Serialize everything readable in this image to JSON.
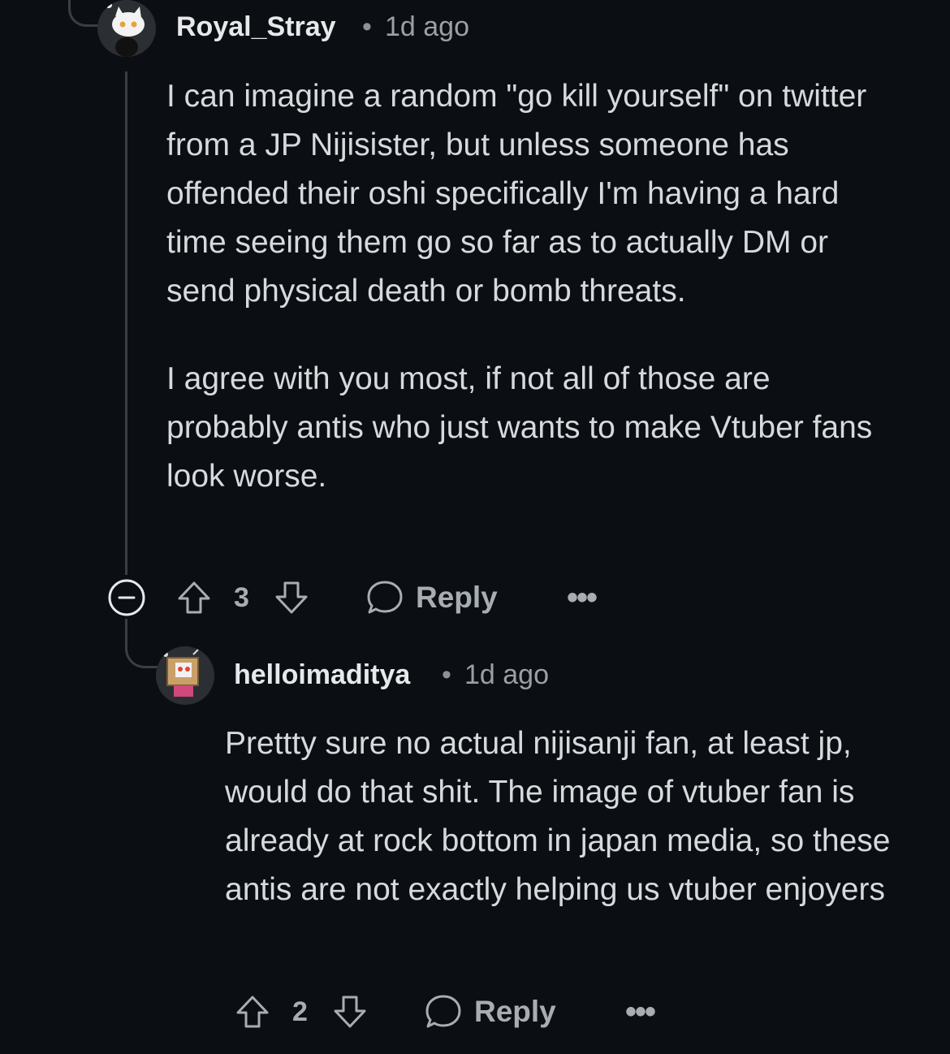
{
  "comments": [
    {
      "username": "Royal_Stray",
      "separator": "•",
      "timestamp": "1d ago",
      "avatar_icon": "white-cat-snoo-avatar",
      "paragraphs": [
        "I can imagine a random \"go kill yourself\" on twitter from a JP Nijisister, but unless someone has offended their oshi specifically I'm having a hard time seeing them go so far as to actually DM or send physical death or bomb threats.",
        "I agree with you most, if not all of those are probably antis who just wants to make Vtuber fans look worse."
      ],
      "votes": "3",
      "reply_label": "Reply",
      "more_label": "•••"
    },
    {
      "username": "helloimaditya",
      "separator": "•",
      "timestamp": "1d ago",
      "avatar_icon": "box-head-snoo-avatar",
      "paragraphs": [
        "Prettty sure no actual nijisanji fan, at least jp, would do that shit. The image of vtuber fan is already at rock bottom in japan media, so these antis are not exactly helping us vtuber enjoyers"
      ],
      "votes": "2",
      "reply_label": "Reply",
      "more_label": "•••"
    }
  ],
  "colors": {
    "background": "#0b0e12",
    "text": "#d7dadc",
    "muted": "#9aa0a6",
    "thread_line": "#3a3f44"
  },
  "icons": [
    "collapse-icon",
    "upvote-icon",
    "downvote-icon",
    "comment-bubble-icon",
    "more-options-icon"
  ]
}
